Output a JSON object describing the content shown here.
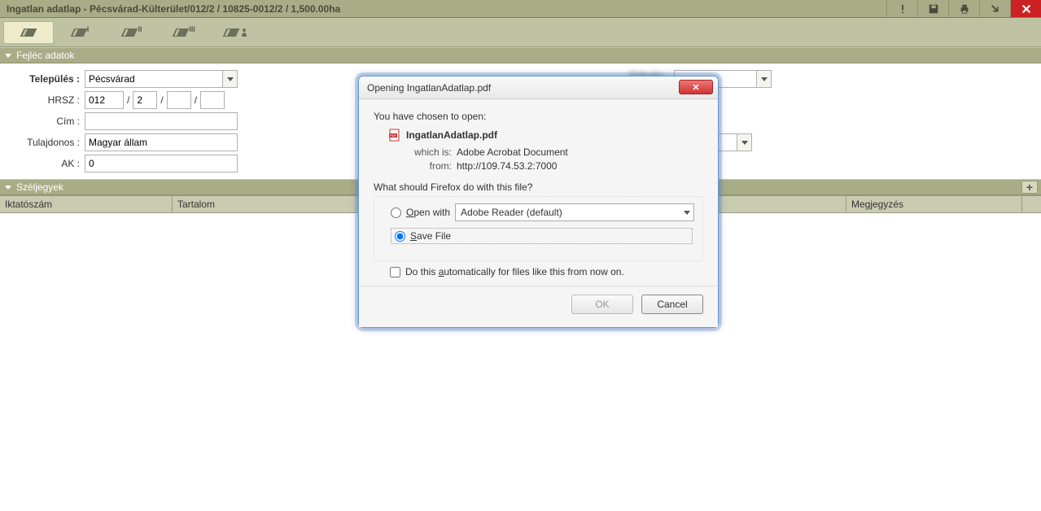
{
  "title": "Ingatlan adatlap - Pécsvárad-Külterület/012/2 / 10825-0012/2 / 1,500.00ha",
  "toolbar": {
    "tabs": [
      "",
      "I",
      "II",
      "III",
      ""
    ]
  },
  "section1": {
    "title": "Fejléc adatok"
  },
  "form": {
    "telepules_label": "Település :",
    "telepules_value": "Pécsvárad",
    "hrsz_label": "HRSZ :",
    "hrsz1": "012",
    "hrsz2": "2",
    "hrsz3": "",
    "hrsz4": "",
    "cim_label": "Cím :",
    "cim_value": "",
    "tulaj_label": "Tulajdonos :",
    "tulaj_value": "Magyar állam",
    "ak_label": "AK :",
    "ak_value": "0"
  },
  "section2": {
    "title": "Széljegyek"
  },
  "table": {
    "col1": "Iktatószám",
    "col2": "Tartalom",
    "col3": "Megjegyzés"
  },
  "dialog": {
    "title": "Opening IngatlanAdatlap.pdf",
    "chosen": "You have chosen to open:",
    "filename": "IngatlanAdatlap.pdf",
    "which_k": "which is:",
    "which_v": "Adobe Acrobat Document",
    "from_k": "from:",
    "from_v": "http://109.74.53.2:7000",
    "what": "What should Firefox do with this file?",
    "open_with": "Open with",
    "app": "Adobe Reader  (default)",
    "save": "Save File",
    "auto": "Do this automatically for files like this from now on.",
    "ok": "OK",
    "cancel": "Cancel"
  }
}
